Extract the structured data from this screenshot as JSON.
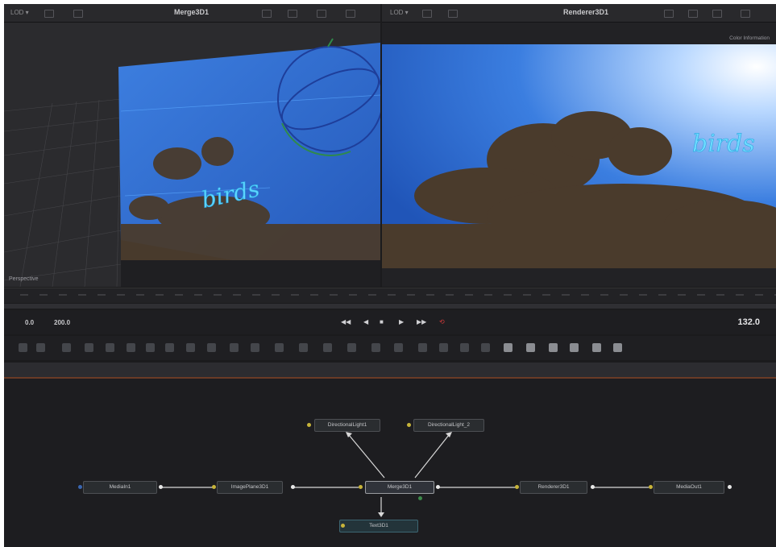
{
  "viewer_left": {
    "lod_label": "LOD ▾",
    "title": "Merge3D1",
    "corner_label": "Perspective"
  },
  "viewer_right": {
    "lod_label": "LOD ▾",
    "title": "Renderer3D1",
    "corner_label": "Color Information"
  },
  "text3d": "birds",
  "transport": {
    "start": "0.0",
    "end": "200.0",
    "timecode": "132.0",
    "controls": [
      "◀◀",
      "◀",
      "■",
      "▶",
      "▶▶",
      "⟲"
    ]
  },
  "nodes": {
    "merge3d": "Merge3D1",
    "light1": "DirectionalLight1",
    "light2": "DirectionalLight_2",
    "text3d": "Text3D1",
    "mediain": "MediaIn1",
    "imageplane": "ImagePlane3D1",
    "renderer": "Renderer3D1",
    "mediaout": "MediaOut1"
  },
  "colors": {
    "app_bg": "#1b1b1d",
    "sky": "#2f6fd8",
    "accent_red": "#d33a3a",
    "port_yellow": "#c7b43a"
  }
}
